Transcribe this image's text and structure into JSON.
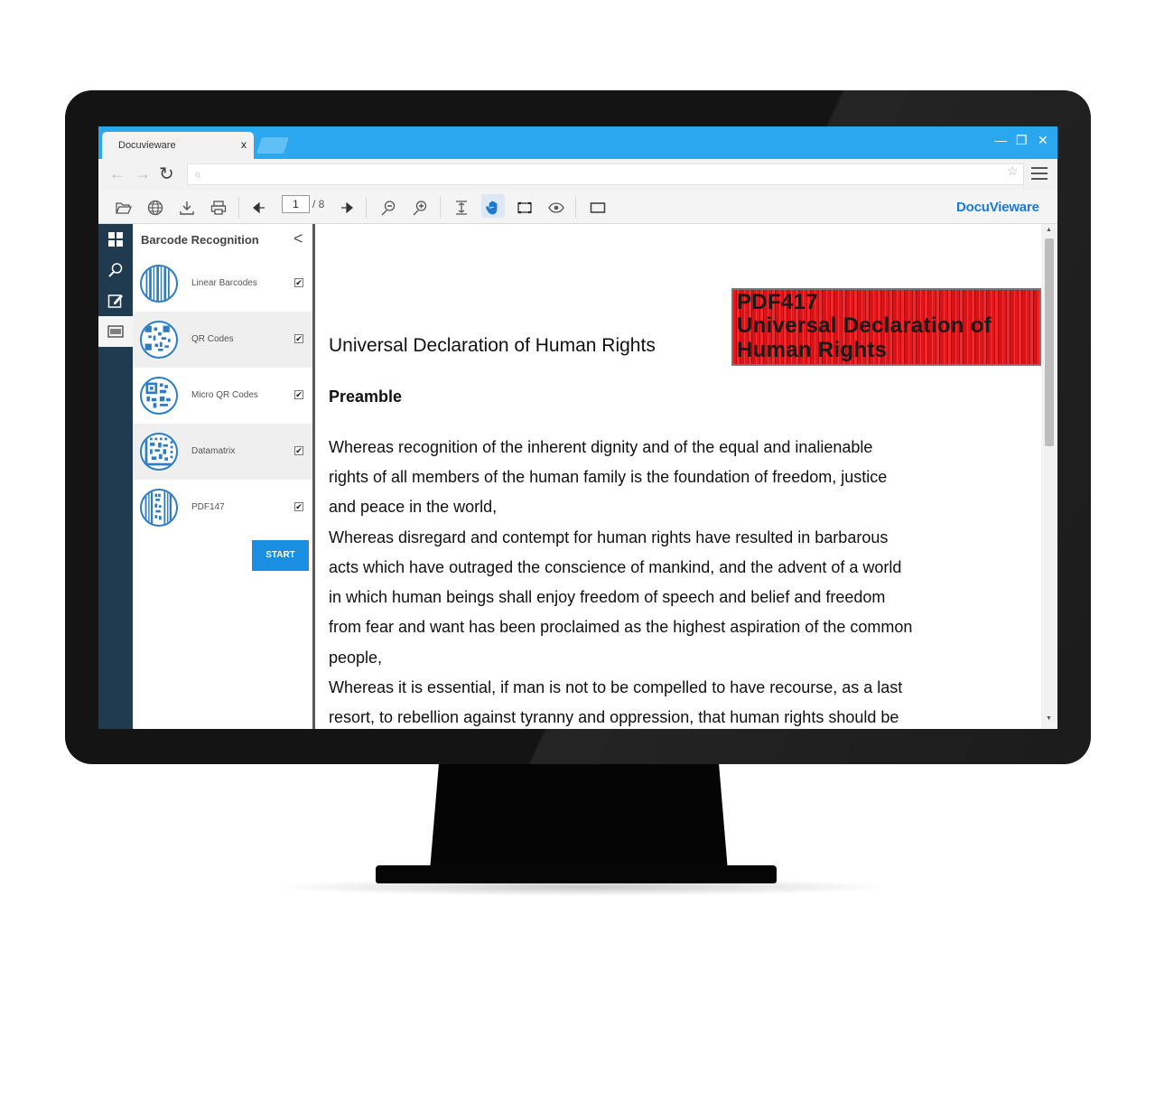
{
  "browser": {
    "tab_title": "Docuvieware",
    "tab_close": "x",
    "back_glyph": "←",
    "forward_glyph": "→",
    "reload_glyph": "↻",
    "address_value": "",
    "search_icon": "⌕",
    "star_icon": "☆",
    "minimize": "—",
    "restore": "❐",
    "close": "✕"
  },
  "toolbar": {
    "current_page": "1",
    "page_total": "/ 8",
    "brand": "DocuVieware",
    "brand_color": "#1c7bd0"
  },
  "panel": {
    "title": "Barcode Recognition",
    "collapse_glyph": "<",
    "items": [
      {
        "label": "Linear Barcodes",
        "checked": true
      },
      {
        "label": "QR Codes",
        "checked": true
      },
      {
        "label": "Micro QR Codes",
        "checked": true
      },
      {
        "label": "Datamatrix",
        "checked": true
      },
      {
        "label": "PDF147",
        "checked": true
      }
    ],
    "check_glyph": "✔",
    "start_label": "START",
    "accent": "#1a8ee0"
  },
  "document": {
    "title": "Universal Declaration of Human Rights",
    "heading": "Preamble",
    "lines": [
      "Whereas recognition of the inherent dignity and of the equal and inalienable",
      "rights of all members of the human family is the foundation of freedom, justice",
      "and peace in the world,",
      "Whereas disregard and contempt for human rights have resulted in barbarous",
      "acts which have outraged the conscience of mankind, and the advent of a world",
      "in which human beings shall enjoy freedom of speech and belief and freedom",
      "from fear and want has been proclaimed as the highest aspiration of the common",
      "people,",
      "Whereas it is essential, if man is not to be compelled to have recourse, as a last",
      "resort, to rebellion against tyranny and oppression, that human rights should be"
    ],
    "barcode_lines": [
      "PDF417",
      "Universal Declaration of",
      "Human Rights"
    ],
    "barcode_color": "#e2161b"
  },
  "scroll": {
    "up_glyph": "▲",
    "down_glyph": "▼"
  }
}
